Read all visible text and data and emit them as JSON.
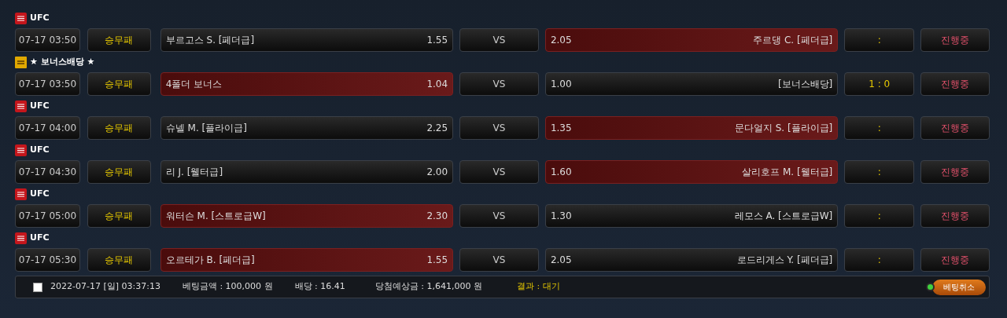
{
  "matches": [
    {
      "league": {
        "kind": "ufc",
        "name": "UFC"
      },
      "time": "07-17 03:50",
      "market": "승무패",
      "home": {
        "name": "부르고스 S. [페더급]",
        "odds": "1.55",
        "selected": false
      },
      "vs": "VS",
      "away": {
        "odds": "2.05",
        "name": "주르댕 C. [페더급]",
        "selected": true
      },
      "score": ":",
      "status": "진행중"
    },
    {
      "league": {
        "kind": "bonus",
        "name": "★ 보너스배당 ★"
      },
      "time": "07-17 03:50",
      "market": "승무패",
      "home": {
        "name": "4폴더 보너스",
        "odds": "1.04",
        "selected": true
      },
      "vs": "VS",
      "away": {
        "odds": "1.00",
        "name": "[보너스배당]",
        "selected": false
      },
      "score": "1 : 0",
      "status": "진행중"
    },
    {
      "league": {
        "kind": "ufc",
        "name": "UFC"
      },
      "time": "07-17 04:00",
      "market": "승무패",
      "home": {
        "name": "슈넬 M. [플라이급]",
        "odds": "2.25",
        "selected": false
      },
      "vs": "VS",
      "away": {
        "odds": "1.35",
        "name": "문다얼지 S. [플라이급]",
        "selected": true
      },
      "score": ":",
      "status": "진행중"
    },
    {
      "league": {
        "kind": "ufc",
        "name": "UFC"
      },
      "time": "07-17 04:30",
      "market": "승무패",
      "home": {
        "name": "리 J. [웰터급]",
        "odds": "2.00",
        "selected": false
      },
      "vs": "VS",
      "away": {
        "odds": "1.60",
        "name": "살리호프 M. [웰터급]",
        "selected": true
      },
      "score": ":",
      "status": "진행중"
    },
    {
      "league": {
        "kind": "ufc",
        "name": "UFC"
      },
      "time": "07-17 05:00",
      "market": "승무패",
      "home": {
        "name": "워터슨 M. [스트로급W]",
        "odds": "2.30",
        "selected": true
      },
      "vs": "VS",
      "away": {
        "odds": "1.30",
        "name": "레모스 A. [스트로급W]",
        "selected": false
      },
      "score": ":",
      "status": "진행중"
    },
    {
      "league": {
        "kind": "ufc",
        "name": "UFC"
      },
      "time": "07-17 05:30",
      "market": "승무패",
      "home": {
        "name": "오르테가 B. [페더급]",
        "odds": "1.55",
        "selected": true
      },
      "vs": "VS",
      "away": {
        "odds": "2.05",
        "name": "로드리게스 Y. [페더급]",
        "selected": false
      },
      "score": ":",
      "status": "진행중"
    }
  ],
  "footer": {
    "checked": false,
    "datetime": "2022-07-17 [일] 03:37:13",
    "amount": "베팅금액 : 100,000 원",
    "odds": "배당 : 16.41",
    "expected": "당첨예상금 : 1,641,000 원",
    "result": "결과 : 대기",
    "cancel": "베팅취소"
  }
}
